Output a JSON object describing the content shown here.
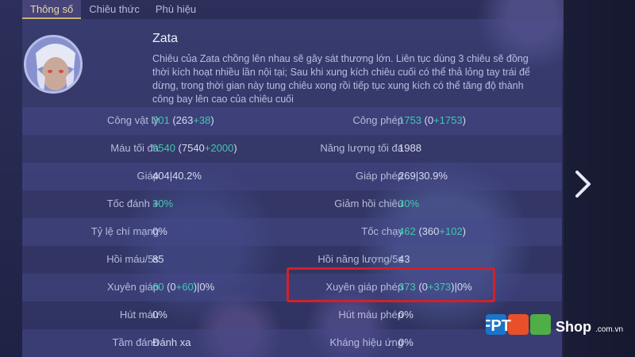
{
  "tabs": [
    "Thông số",
    "Chiêu thức",
    "Phù hiệu"
  ],
  "hero": {
    "name": "Zata",
    "description": "Chiêu của Zata chồng lên nhau sẽ gây sát thương lớn. Liên tục dùng 3 chiêu sẽ đồng thời kích hoạt nhiều lần nội tại; Sau khi xung kích chiêu cuối có thể thả lỏng tay trái để dừng, trong thời gian này tung chiêu xong rồi tiếp tục xung kích có thể tăng độ thành công bay lên cao của chiêu cuối"
  },
  "stats": [
    {
      "left": {
        "label": "Công vật lý",
        "base": "301",
        "open": " (263",
        "bonus": "+38",
        "close": ")",
        "tail": ""
      },
      "right": {
        "label": "Công phép",
        "base": "1753",
        "open": " (0",
        "bonus": "+1753",
        "close": ")",
        "tail": ""
      }
    },
    {
      "left": {
        "label": "Máu tối đa",
        "base": "9540",
        "open": " (7540",
        "bonus": "+2000",
        "close": ")",
        "tail": ""
      },
      "right": {
        "label": "Năng lượng tối đa",
        "base": "1988",
        "open": "",
        "bonus": "",
        "close": "",
        "tail": ""
      }
    },
    {
      "left": {
        "label": "Giáp",
        "base": "404",
        "open": "",
        "bonus": "",
        "close": "",
        "tail": "|40.2%"
      },
      "right": {
        "label": "Giáp phép",
        "base": "269",
        "open": "",
        "bonus": "",
        "close": "",
        "tail": "|30.9%"
      }
    },
    {
      "left": {
        "label": "Tốc đánh +",
        "base": "30%",
        "open": "",
        "bonus": "",
        "close": "",
        "tail": ""
      },
      "right": {
        "label": "Giảm hồi chiêu",
        "base": "30%",
        "open": "",
        "bonus": "",
        "close": "",
        "tail": ""
      }
    },
    {
      "left": {
        "label": "Tỷ lệ chí mạng",
        "base": "0%",
        "open": "",
        "bonus": "",
        "close": "",
        "tail": ""
      },
      "right": {
        "label": "Tốc chạy",
        "base": "462",
        "open": " (360",
        "bonus": "+102",
        "close": ")",
        "tail": ""
      }
    },
    {
      "left": {
        "label": "Hồi máu/5s",
        "base": "85",
        "open": "",
        "bonus": "",
        "close": "",
        "tail": ""
      },
      "right": {
        "label": "Hồi năng lượng/5s",
        "base": "43",
        "open": "",
        "bonus": "",
        "close": "",
        "tail": ""
      }
    },
    {
      "left": {
        "label": "Xuyên giáp",
        "base": "60",
        "open": " (0",
        "bonus": "+60",
        "close": ")",
        "tail": "|0%"
      },
      "right": {
        "label": "Xuyên giáp phép",
        "base": "373",
        "open": " (0",
        "bonus": "+373",
        "close": ")",
        "tail": "|0%"
      }
    },
    {
      "left": {
        "label": "Hút máu",
        "base": "0%",
        "open": "",
        "bonus": "",
        "close": "",
        "tail": ""
      },
      "right": {
        "label": "Hút máu phép",
        "base": "0%",
        "open": "",
        "bonus": "",
        "close": "",
        "tail": ""
      }
    },
    {
      "left": {
        "label": "Tầm đánh",
        "base": "Đánh xa",
        "open": "",
        "bonus": "",
        "close": "",
        "tail": ""
      },
      "right": {
        "label": "Kháng hiệu ứng",
        "base": "0%",
        "open": "",
        "bonus": "",
        "close": "",
        "tail": ""
      }
    }
  ],
  "watermark": {
    "brand": "FPT",
    "shop": "Shop",
    "domain": ".com.vn"
  },
  "colors": {
    "accent_green": "#41c9b0",
    "highlight": "#d0212a",
    "tab_active": "#e9d9a6"
  },
  "icons": {
    "next": "chevron-right-icon"
  }
}
